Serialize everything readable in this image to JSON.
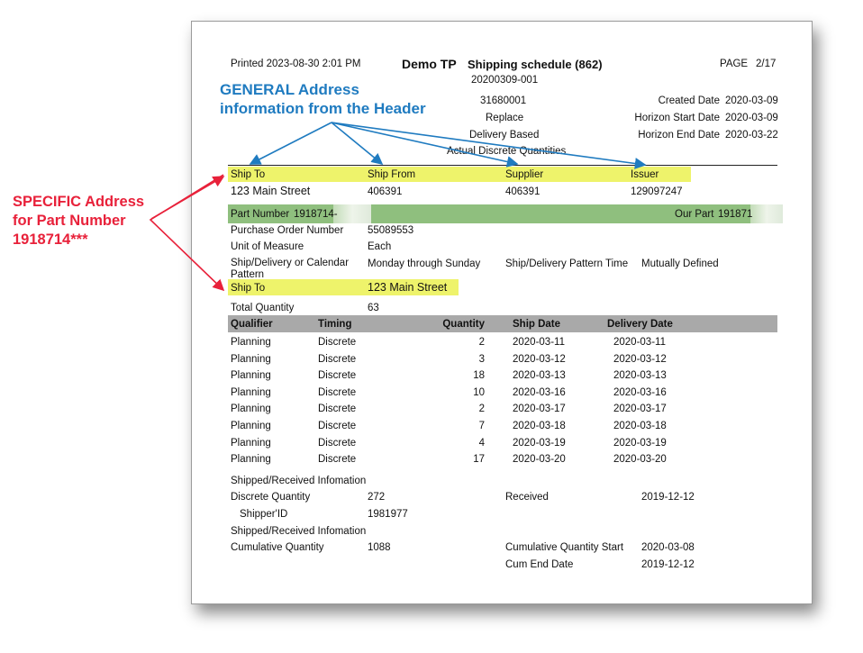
{
  "header": {
    "printed": "Printed 2023-08-30 2:01 PM",
    "company": "Demo TP",
    "doc_title": "Shipping schedule (862)",
    "page_label": "PAGE",
    "page_value": "2/17",
    "ref_number": "20200309-001",
    "release_number": "31680001",
    "purpose": "Replace",
    "schedule_type": "Delivery Based",
    "quantity_type": "Actual Discrete Quantities",
    "created_label": "Created Date",
    "created_value": "2020-03-09",
    "horizon_start_label": "Horizon Start Date",
    "horizon_start_value": "2020-03-09",
    "horizon_end_label": "Horizon End Date",
    "horizon_end_value": "2020-03-22"
  },
  "addresses": {
    "ship_to_label": "Ship To",
    "ship_from_label": "Ship From",
    "supplier_label": "Supplier",
    "issuer_label": "Issuer",
    "ship_to_value": "123 Main Street",
    "ship_from_value": "406391",
    "supplier_value": "406391",
    "issuer_value": "129097247"
  },
  "part": {
    "part_number_label": "Part Number",
    "part_number_value": "1918714-",
    "our_part_label": "Our Part",
    "our_part_value": "191871",
    "po_label": "Purchase Order Number",
    "po_value": "55089553",
    "uom_label": "Unit of Measure",
    "uom_value": "Each",
    "pattern_label": "Ship/Delivery or Calendar Pattern",
    "pattern_value": "Monday through Sunday",
    "pattern_time_label": "Ship/Delivery Pattern Time",
    "pattern_time_value": "Mutually Defined",
    "ship_to_label": "Ship To",
    "ship_to_value": "123 Main Street",
    "total_qty_label": "Total Quantity",
    "total_qty_value": "63"
  },
  "schedule": {
    "columns": [
      "Qualifier",
      "Timing",
      "Quantity",
      "Ship Date",
      "Delivery Date"
    ],
    "rows": [
      [
        "Planning",
        "Discrete",
        "2",
        "2020-03-11",
        "2020-03-11"
      ],
      [
        "Planning",
        "Discrete",
        "3",
        "2020-03-12",
        "2020-03-12"
      ],
      [
        "Planning",
        "Discrete",
        "18",
        "2020-03-13",
        "2020-03-13"
      ],
      [
        "Planning",
        "Discrete",
        "10",
        "2020-03-16",
        "2020-03-16"
      ],
      [
        "Planning",
        "Discrete",
        "2",
        "2020-03-17",
        "2020-03-17"
      ],
      [
        "Planning",
        "Discrete",
        "7",
        "2020-03-18",
        "2020-03-18"
      ],
      [
        "Planning",
        "Discrete",
        "4",
        "2020-03-19",
        "2020-03-19"
      ],
      [
        "Planning",
        "Discrete",
        "17",
        "2020-03-20",
        "2020-03-20"
      ]
    ]
  },
  "shipped": {
    "section1_title": "Shipped/Received Infomation",
    "discrete_qty_label": "Discrete Quantity",
    "discrete_qty_value": "272",
    "received_label": "Received",
    "received_value": "2019-12-12",
    "shipper_id_label": "Shipper'ID",
    "shipper_id_value": "1981977",
    "section2_title": "Shipped/Received Infomation",
    "cum_qty_label": "Cumulative Quantity",
    "cum_qty_value": "1088",
    "cum_start_label": "Cumulative Quantity Start",
    "cum_start_value": "2020-03-08",
    "cum_end_label": "Cum End Date",
    "cum_end_value": "2019-12-12"
  },
  "annotations": {
    "general_line1": "GENERAL Address",
    "general_line2": "information from the Header",
    "specific_line1": "SPECIFIC Address",
    "specific_line2": "for Part Number",
    "specific_line3": "1918714***"
  },
  "colors": {
    "highlight": "#eef36b",
    "part_bar": "#8fbf7e",
    "table_header": "#a9a9a9",
    "annotation_blue": "#1f7bc0",
    "annotation_red": "#e8213a"
  }
}
